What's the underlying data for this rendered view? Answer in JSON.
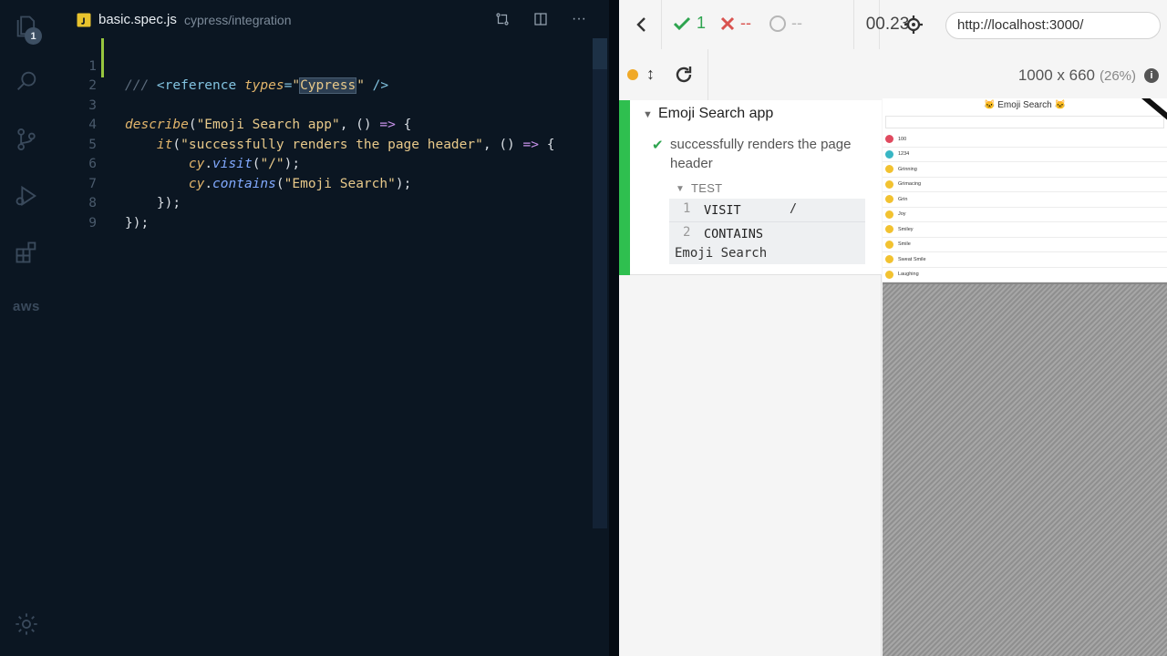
{
  "editor": {
    "activity_badge": "1",
    "aws_label": "aws",
    "tab": {
      "filename": "basic.spec.js",
      "path": "cypress/integration"
    },
    "line_numbers": [
      "1",
      "2",
      "3",
      "4",
      "5",
      "6",
      "7",
      "8",
      "9"
    ]
  },
  "cypress": {
    "stats": {
      "passed": "1",
      "failed": "--",
      "pending": "--",
      "duration": "00.23"
    },
    "url": "http://localhost:3000/",
    "viewport": {
      "size": "1000 x 660",
      "scale": "(26%)"
    },
    "suite": {
      "title": "Emoji Search app",
      "test": {
        "title": "successfully renders the page header",
        "section": "TEST",
        "commands": [
          {
            "num": "1",
            "name": "VISIT",
            "arg": "/"
          },
          {
            "num": "2",
            "name": "CONTAINS",
            "arg": "Emoji Search"
          }
        ]
      }
    },
    "app_preview": {
      "title": "Emoji Search",
      "items": [
        "100",
        "1234",
        "Grinning",
        "Grimacing",
        "Grin",
        "Joy",
        "Smiley",
        "Smile",
        "Sweat Smile",
        "Laughing"
      ]
    }
  }
}
